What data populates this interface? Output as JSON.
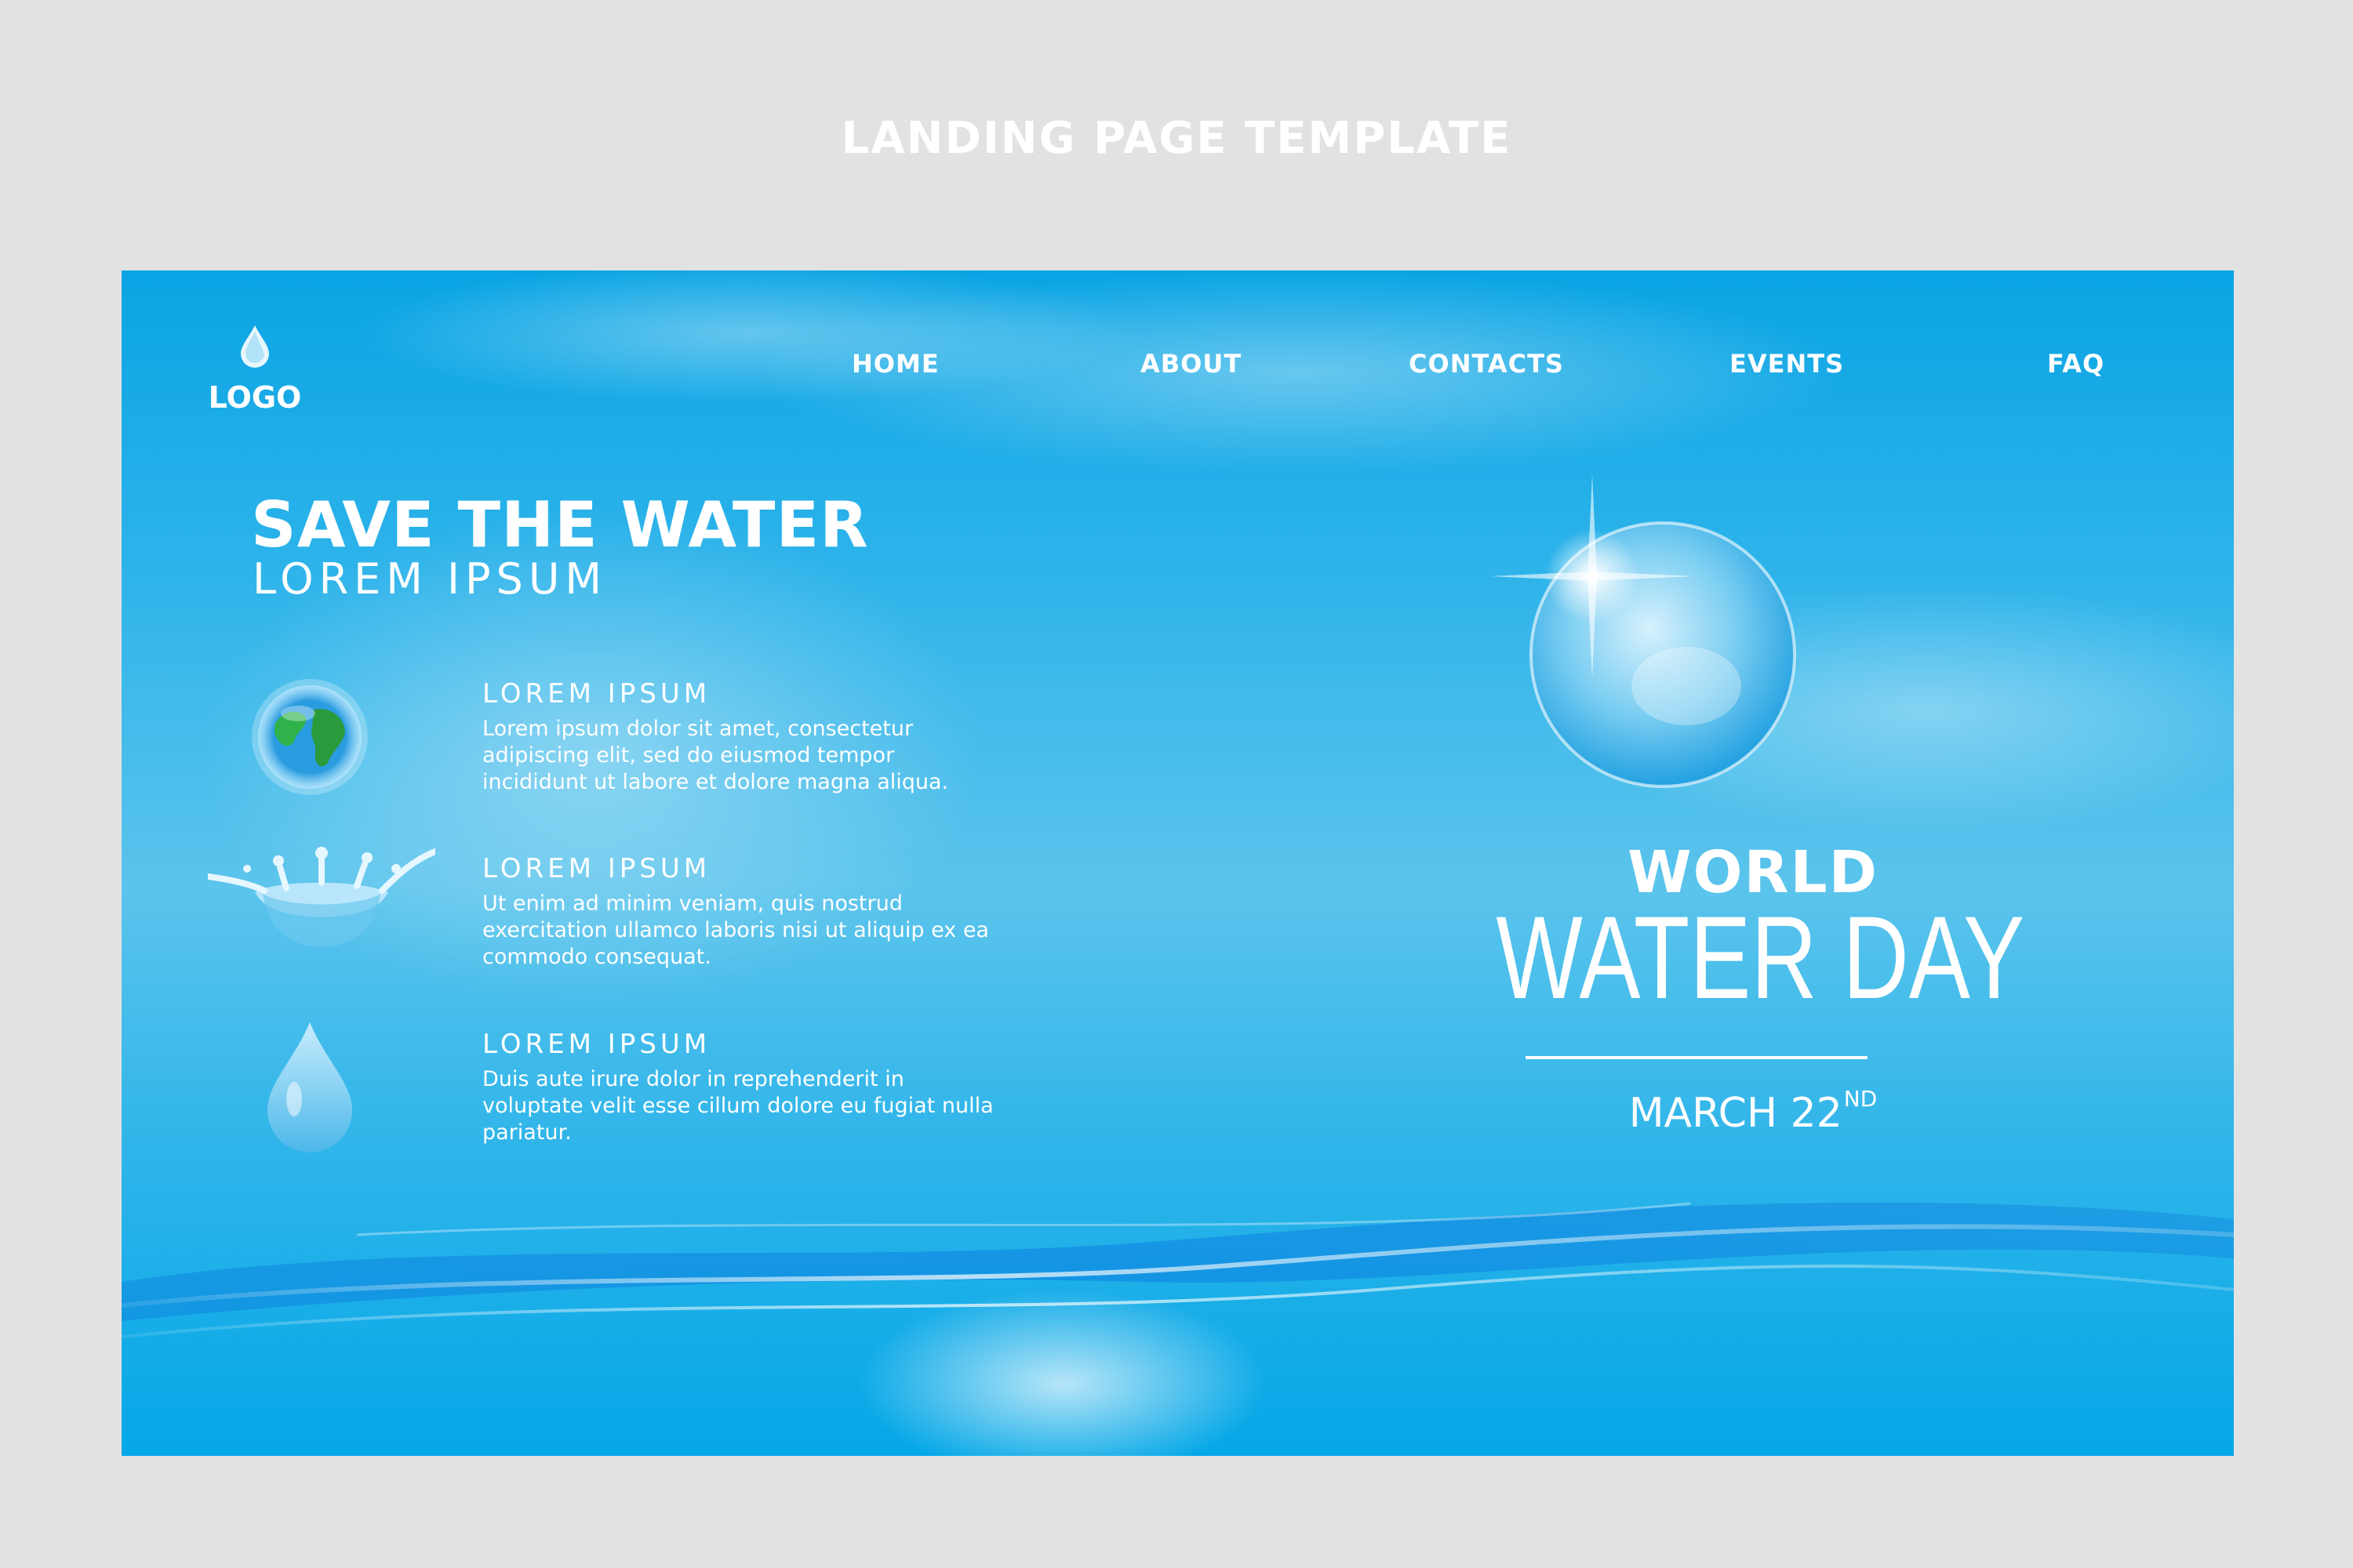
{
  "page": {
    "heading": "LANDING PAGE TEMPLATE"
  },
  "logo": {
    "label": "LOGO",
    "icon": "water-drop-icon"
  },
  "nav": [
    {
      "label": "HOME"
    },
    {
      "label": "ABOUT"
    },
    {
      "label": "CONTACTS"
    },
    {
      "label": "EVENTS"
    },
    {
      "label": "FAQ"
    }
  ],
  "hero": {
    "title": "SAVE THE WATER",
    "subtitle": "LOREM IPSUM"
  },
  "features": [
    {
      "icon": "earth-globe-icon",
      "title": "LOREM IPSUM",
      "text": "Lorem ipsum dolor sit amet, consectetur adipiscing elit, sed do eiusmod tempor incididunt ut labore et dolore magna aliqua."
    },
    {
      "icon": "water-splash-icon",
      "title": "LOREM IPSUM",
      "text": "Ut enim ad minim veniam, quis nostrud exercitation ullamco laboris nisi ut aliquip ex ea commodo consequat."
    },
    {
      "icon": "water-drop-icon",
      "title": "LOREM IPSUM",
      "text": "Duis aute irure dolor in reprehenderit in voluptate velit esse cillum dolore eu fugiat nulla pariatur."
    }
  ],
  "event": {
    "line1": "WORLD",
    "line2": "WATER DAY",
    "date": "MARCH 22",
    "date_suffix": "ND"
  },
  "colors": {
    "page_background": "#e2e2e2",
    "banner_top": "#0aa4e4",
    "banner_mid": "#5bc4ec",
    "text": "#ffffff"
  }
}
